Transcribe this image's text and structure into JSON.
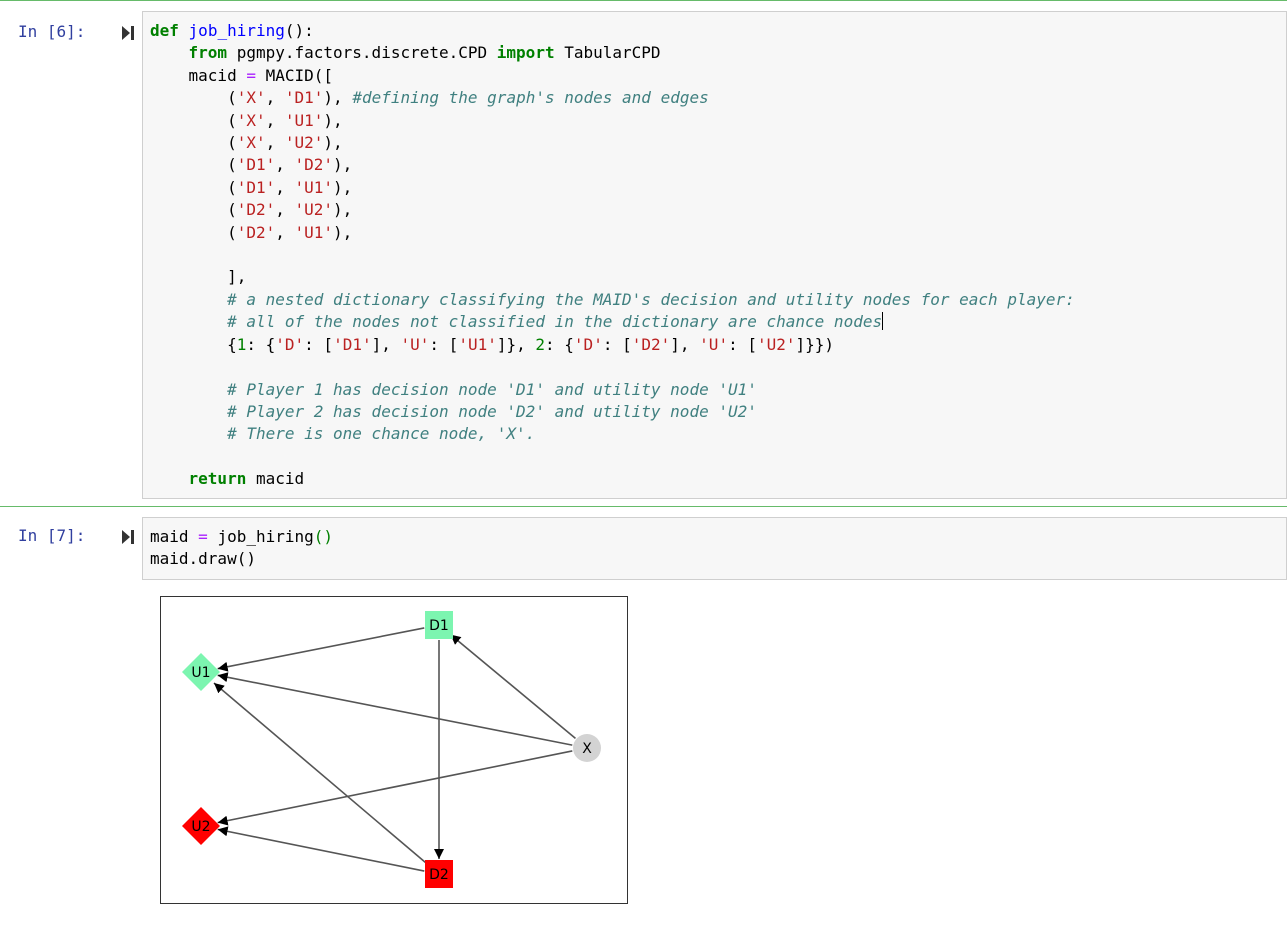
{
  "cells": [
    {
      "prompt": "In [6]:",
      "code_lines": [
        [
          {
            "t": "def",
            "c": "kw"
          },
          {
            "t": " "
          },
          {
            "t": "job_hiring",
            "c": "fn"
          },
          {
            "t": "():"
          }
        ],
        [
          {
            "t": "    "
          },
          {
            "t": "from",
            "c": "kw"
          },
          {
            "t": " pgmpy.factors.discrete.CPD "
          },
          {
            "t": "import",
            "c": "kw"
          },
          {
            "t": " TabularCPD"
          }
        ],
        [
          {
            "t": "    macid "
          },
          {
            "t": "=",
            "c": "op"
          },
          {
            "t": " MACID(["
          }
        ],
        [
          {
            "t": "        ("
          },
          {
            "t": "'X'",
            "c": "st"
          },
          {
            "t": ", "
          },
          {
            "t": "'D1'",
            "c": "st"
          },
          {
            "t": "), "
          },
          {
            "t": "#defining the graph's nodes and edges",
            "c": "cm"
          }
        ],
        [
          {
            "t": "        ("
          },
          {
            "t": "'X'",
            "c": "st"
          },
          {
            "t": ", "
          },
          {
            "t": "'U1'",
            "c": "st"
          },
          {
            "t": "),"
          }
        ],
        [
          {
            "t": "        ("
          },
          {
            "t": "'X'",
            "c": "st"
          },
          {
            "t": ", "
          },
          {
            "t": "'U2'",
            "c": "st"
          },
          {
            "t": "),"
          }
        ],
        [
          {
            "t": "        ("
          },
          {
            "t": "'D1'",
            "c": "st"
          },
          {
            "t": ", "
          },
          {
            "t": "'D2'",
            "c": "st"
          },
          {
            "t": "),"
          }
        ],
        [
          {
            "t": "        ("
          },
          {
            "t": "'D1'",
            "c": "st"
          },
          {
            "t": ", "
          },
          {
            "t": "'U1'",
            "c": "st"
          },
          {
            "t": "),"
          }
        ],
        [
          {
            "t": "        ("
          },
          {
            "t": "'D2'",
            "c": "st"
          },
          {
            "t": ", "
          },
          {
            "t": "'U2'",
            "c": "st"
          },
          {
            "t": "),"
          }
        ],
        [
          {
            "t": "        ("
          },
          {
            "t": "'D2'",
            "c": "st"
          },
          {
            "t": ", "
          },
          {
            "t": "'U1'",
            "c": "st"
          },
          {
            "t": "),"
          }
        ],
        [
          {
            "t": ""
          }
        ],
        [
          {
            "t": "        ],"
          }
        ],
        [
          {
            "t": "        "
          },
          {
            "t": "# a nested dictionary classifying the MAID's decision and utility nodes for each player:",
            "c": "cm"
          }
        ],
        [
          {
            "t": "        "
          },
          {
            "t": "# all of the nodes not classified in the dictionary are chance nodes",
            "c": "cm"
          },
          {
            "caret": true
          }
        ],
        [
          {
            "t": "        {"
          },
          {
            "t": "1",
            "c": "nm"
          },
          {
            "t": ": {"
          },
          {
            "t": "'D'",
            "c": "st"
          },
          {
            "t": ": ["
          },
          {
            "t": "'D1'",
            "c": "st"
          },
          {
            "t": "], "
          },
          {
            "t": "'U'",
            "c": "st"
          },
          {
            "t": ": ["
          },
          {
            "t": "'U1'",
            "c": "st"
          },
          {
            "t": "]}, "
          },
          {
            "t": "2",
            "c": "nm"
          },
          {
            "t": ": {"
          },
          {
            "t": "'D'",
            "c": "st"
          },
          {
            "t": ": ["
          },
          {
            "t": "'D2'",
            "c": "st"
          },
          {
            "t": "], "
          },
          {
            "t": "'U'",
            "c": "st"
          },
          {
            "t": ": ["
          },
          {
            "t": "'U2'",
            "c": "st"
          },
          {
            "t": "]}})"
          }
        ],
        [
          {
            "t": ""
          }
        ],
        [
          {
            "t": "        "
          },
          {
            "t": "# Player 1 has decision node 'D1' and utility node 'U1'",
            "c": "cm"
          }
        ],
        [
          {
            "t": "        "
          },
          {
            "t": "# Player 2 has decision node 'D2' and utility node 'U2'",
            "c": "cm"
          }
        ],
        [
          {
            "t": "        "
          },
          {
            "t": "# There is one chance node, 'X'.",
            "c": "cm"
          }
        ],
        [
          {
            "t": ""
          }
        ],
        [
          {
            "t": "    "
          },
          {
            "t": "return",
            "c": "kw"
          },
          {
            "t": " macid"
          }
        ]
      ]
    },
    {
      "prompt": "In [7]:",
      "code_lines": [
        [
          {
            "t": "maid "
          },
          {
            "t": "=",
            "c": "op"
          },
          {
            "t": " job_hiring"
          },
          {
            "t": "()",
            "c": "nm"
          }
        ],
        [
          {
            "t": "maid.draw()"
          }
        ]
      ]
    }
  ],
  "graph": {
    "nodes": [
      {
        "id": "D1",
        "label": "D1",
        "shape": "square",
        "color": "#7cf5b0"
      },
      {
        "id": "U1",
        "label": "U1",
        "shape": "diamond",
        "color": "#7cf5b0"
      },
      {
        "id": "X",
        "label": "X",
        "shape": "circle",
        "color": "#d3d3d3"
      },
      {
        "id": "U2",
        "label": "U2",
        "shape": "diamond",
        "color": "#ff0000"
      },
      {
        "id": "D2",
        "label": "D2",
        "shape": "square",
        "color": "#ff0000"
      }
    ],
    "edges": [
      [
        "X",
        "D1"
      ],
      [
        "X",
        "U1"
      ],
      [
        "X",
        "U2"
      ],
      [
        "D1",
        "D2"
      ],
      [
        "D1",
        "U1"
      ],
      [
        "D2",
        "U2"
      ],
      [
        "D2",
        "U1"
      ]
    ]
  },
  "colors": {
    "prompt": "#303f9f",
    "selected_border": "#66bb6a",
    "edge": "#555555"
  }
}
